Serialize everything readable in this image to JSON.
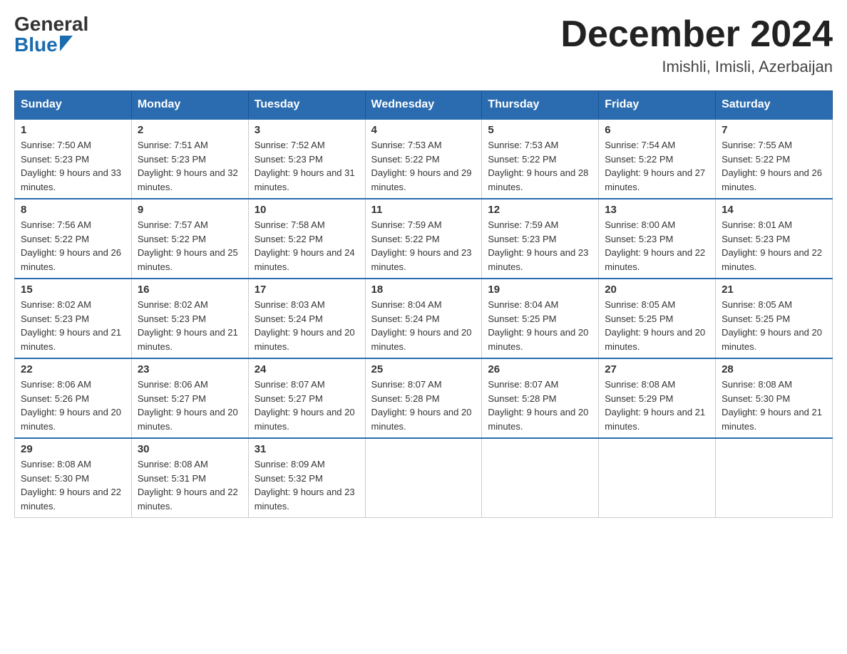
{
  "logo": {
    "general": "General",
    "blue": "Blue"
  },
  "header": {
    "month": "December 2024",
    "location": "Imishli, Imisli, Azerbaijan"
  },
  "days_of_week": [
    "Sunday",
    "Monday",
    "Tuesday",
    "Wednesday",
    "Thursday",
    "Friday",
    "Saturday"
  ],
  "weeks": [
    [
      {
        "day": "1",
        "sunrise": "7:50 AM",
        "sunset": "5:23 PM",
        "daylight": "9 hours and 33 minutes."
      },
      {
        "day": "2",
        "sunrise": "7:51 AM",
        "sunset": "5:23 PM",
        "daylight": "9 hours and 32 minutes."
      },
      {
        "day": "3",
        "sunrise": "7:52 AM",
        "sunset": "5:23 PM",
        "daylight": "9 hours and 31 minutes."
      },
      {
        "day": "4",
        "sunrise": "7:53 AM",
        "sunset": "5:22 PM",
        "daylight": "9 hours and 29 minutes."
      },
      {
        "day": "5",
        "sunrise": "7:53 AM",
        "sunset": "5:22 PM",
        "daylight": "9 hours and 28 minutes."
      },
      {
        "day": "6",
        "sunrise": "7:54 AM",
        "sunset": "5:22 PM",
        "daylight": "9 hours and 27 minutes."
      },
      {
        "day": "7",
        "sunrise": "7:55 AM",
        "sunset": "5:22 PM",
        "daylight": "9 hours and 26 minutes."
      }
    ],
    [
      {
        "day": "8",
        "sunrise": "7:56 AM",
        "sunset": "5:22 PM",
        "daylight": "9 hours and 26 minutes."
      },
      {
        "day": "9",
        "sunrise": "7:57 AM",
        "sunset": "5:22 PM",
        "daylight": "9 hours and 25 minutes."
      },
      {
        "day": "10",
        "sunrise": "7:58 AM",
        "sunset": "5:22 PM",
        "daylight": "9 hours and 24 minutes."
      },
      {
        "day": "11",
        "sunrise": "7:59 AM",
        "sunset": "5:22 PM",
        "daylight": "9 hours and 23 minutes."
      },
      {
        "day": "12",
        "sunrise": "7:59 AM",
        "sunset": "5:23 PM",
        "daylight": "9 hours and 23 minutes."
      },
      {
        "day": "13",
        "sunrise": "8:00 AM",
        "sunset": "5:23 PM",
        "daylight": "9 hours and 22 minutes."
      },
      {
        "day": "14",
        "sunrise": "8:01 AM",
        "sunset": "5:23 PM",
        "daylight": "9 hours and 22 minutes."
      }
    ],
    [
      {
        "day": "15",
        "sunrise": "8:02 AM",
        "sunset": "5:23 PM",
        "daylight": "9 hours and 21 minutes."
      },
      {
        "day": "16",
        "sunrise": "8:02 AM",
        "sunset": "5:23 PM",
        "daylight": "9 hours and 21 minutes."
      },
      {
        "day": "17",
        "sunrise": "8:03 AM",
        "sunset": "5:24 PM",
        "daylight": "9 hours and 20 minutes."
      },
      {
        "day": "18",
        "sunrise": "8:04 AM",
        "sunset": "5:24 PM",
        "daylight": "9 hours and 20 minutes."
      },
      {
        "day": "19",
        "sunrise": "8:04 AM",
        "sunset": "5:25 PM",
        "daylight": "9 hours and 20 minutes."
      },
      {
        "day": "20",
        "sunrise": "8:05 AM",
        "sunset": "5:25 PM",
        "daylight": "9 hours and 20 minutes."
      },
      {
        "day": "21",
        "sunrise": "8:05 AM",
        "sunset": "5:25 PM",
        "daylight": "9 hours and 20 minutes."
      }
    ],
    [
      {
        "day": "22",
        "sunrise": "8:06 AM",
        "sunset": "5:26 PM",
        "daylight": "9 hours and 20 minutes."
      },
      {
        "day": "23",
        "sunrise": "8:06 AM",
        "sunset": "5:27 PM",
        "daylight": "9 hours and 20 minutes."
      },
      {
        "day": "24",
        "sunrise": "8:07 AM",
        "sunset": "5:27 PM",
        "daylight": "9 hours and 20 minutes."
      },
      {
        "day": "25",
        "sunrise": "8:07 AM",
        "sunset": "5:28 PM",
        "daylight": "9 hours and 20 minutes."
      },
      {
        "day": "26",
        "sunrise": "8:07 AM",
        "sunset": "5:28 PM",
        "daylight": "9 hours and 20 minutes."
      },
      {
        "day": "27",
        "sunrise": "8:08 AM",
        "sunset": "5:29 PM",
        "daylight": "9 hours and 21 minutes."
      },
      {
        "day": "28",
        "sunrise": "8:08 AM",
        "sunset": "5:30 PM",
        "daylight": "9 hours and 21 minutes."
      }
    ],
    [
      {
        "day": "29",
        "sunrise": "8:08 AM",
        "sunset": "5:30 PM",
        "daylight": "9 hours and 22 minutes."
      },
      {
        "day": "30",
        "sunrise": "8:08 AM",
        "sunset": "5:31 PM",
        "daylight": "9 hours and 22 minutes."
      },
      {
        "day": "31",
        "sunrise": "8:09 AM",
        "sunset": "5:32 PM",
        "daylight": "9 hours and 23 minutes."
      },
      null,
      null,
      null,
      null
    ]
  ]
}
